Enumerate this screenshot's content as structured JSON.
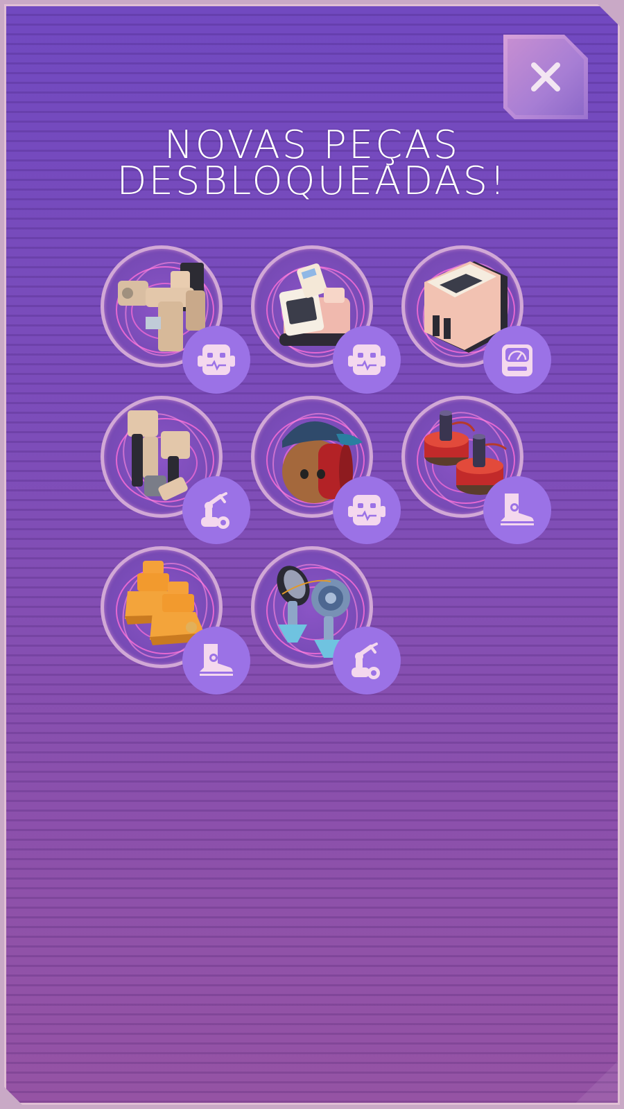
{
  "popup": {
    "title_line1": "NOVAS PEÇAS",
    "title_line2": "DESBLOQUEADAS!",
    "close_icon": "close-icon"
  },
  "colors": {
    "panel_top": "#7149c0",
    "panel_bottom": "#9553a4",
    "badge": "#9b72e6",
    "ring_glow": "#ff6fd8",
    "icon_tint": "#f4d8ee"
  },
  "parts": [
    {
      "part": "arm-piece",
      "category_icon": "robot-head-icon"
    },
    {
      "part": "register-head-piece",
      "category_icon": "robot-head-icon"
    },
    {
      "part": "machine-body-piece",
      "category_icon": "robot-body-icon"
    },
    {
      "part": "claw-arm-piece",
      "category_icon": "robot-arm-icon"
    },
    {
      "part": "cap-barrel-head-piece",
      "category_icon": "robot-head-icon"
    },
    {
      "part": "red-coil-legs-piece",
      "category_icon": "boot-icon"
    },
    {
      "part": "orange-boots-piece",
      "category_icon": "boot-icon"
    },
    {
      "part": "blue-wheel-arm-piece",
      "category_icon": "robot-arm-icon"
    }
  ]
}
